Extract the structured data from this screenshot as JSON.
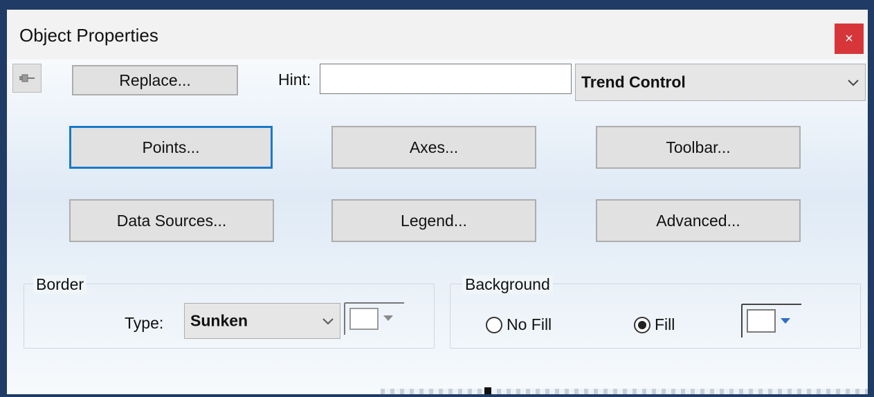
{
  "window": {
    "title": "Object Properties",
    "close_label": "×"
  },
  "toolbar": {
    "replace_label": "Replace...",
    "hint_label": "Hint:",
    "hint_value": "",
    "object_type": "Trend Control"
  },
  "buttons": [
    {
      "label": "Points..."
    },
    {
      "label": "Axes..."
    },
    {
      "label": "Toolbar..."
    },
    {
      "label": "Data Sources..."
    },
    {
      "label": "Legend..."
    },
    {
      "label": "Advanced..."
    }
  ],
  "border": {
    "group_label": "Border",
    "type_label": "Type:",
    "type_value": "Sunken",
    "color": "#ffffff"
  },
  "background": {
    "group_label": "Background",
    "no_fill_label": "No Fill",
    "fill_label": "Fill",
    "selected": "Fill",
    "color": "#ffffff"
  },
  "colors": {
    "accent": "#1979ca",
    "close": "#d6363a",
    "frame": "#1f3b66"
  }
}
